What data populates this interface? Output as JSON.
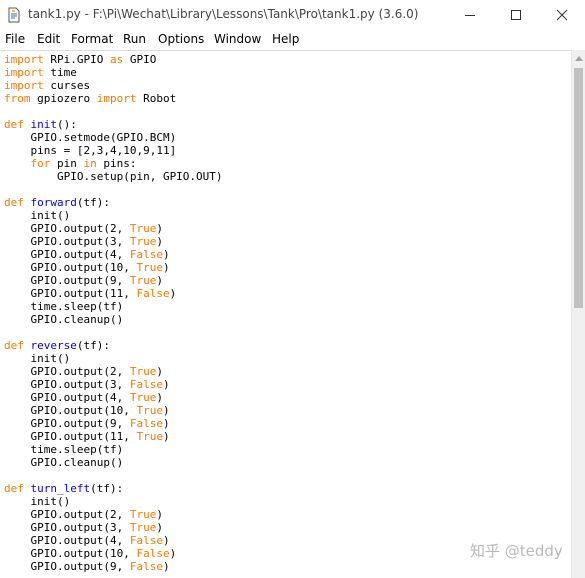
{
  "window": {
    "title": "tank1.py - F:\\Pi\\Wechat\\Library\\Lessons\\Tank\\Pro\\tank1.py (3.6.0)",
    "icon": "python-file-icon",
    "buttons": [
      "minimize",
      "maximize",
      "close"
    ]
  },
  "menu": [
    "File",
    "Edit",
    "Format",
    "Run",
    "Options",
    "Window",
    "Help"
  ],
  "code_lines": [
    "import RPi.GPIO as GPIO",
    "import time",
    "import curses",
    "from gpiozero import Robot",
    "",
    "def init():",
    "    GPIO.setmode(GPIO.BCM)",
    "    pins = [2,3,4,10,9,11]",
    "    for pin in pins:",
    "        GPIO.setup(pin, GPIO.OUT)",
    "",
    "def forward(tf):",
    "    init()",
    "    GPIO.output(2, True)",
    "    GPIO.output(3, True)",
    "    GPIO.output(4, False)",
    "    GPIO.output(10, True)",
    "    GPIO.output(9, True)",
    "    GPIO.output(11, False)",
    "    time.sleep(tf)",
    "    GPIO.cleanup()",
    "",
    "def reverse(tf):",
    "    init()",
    "    GPIO.output(2, True)",
    "    GPIO.output(3, False)",
    "    GPIO.output(4, True)",
    "    GPIO.output(10, True)",
    "    GPIO.output(9, False)",
    "    GPIO.output(11, True)",
    "    time.sleep(tf)",
    "    GPIO.cleanup()",
    "",
    "def turn_left(tf):",
    "    init()",
    "    GPIO.output(2, True)",
    "    GPIO.output(3, True)",
    "    GPIO.output(4, False)",
    "    GPIO.output(10, False)",
    "    GPIO.output(9, False)"
  ],
  "watermark": "知乎 @teddy",
  "colors": {
    "keyword": "#ff7700",
    "definition": "#0000ff",
    "text": "#000000",
    "scrollbar_thumb": "#c1c1c1"
  }
}
